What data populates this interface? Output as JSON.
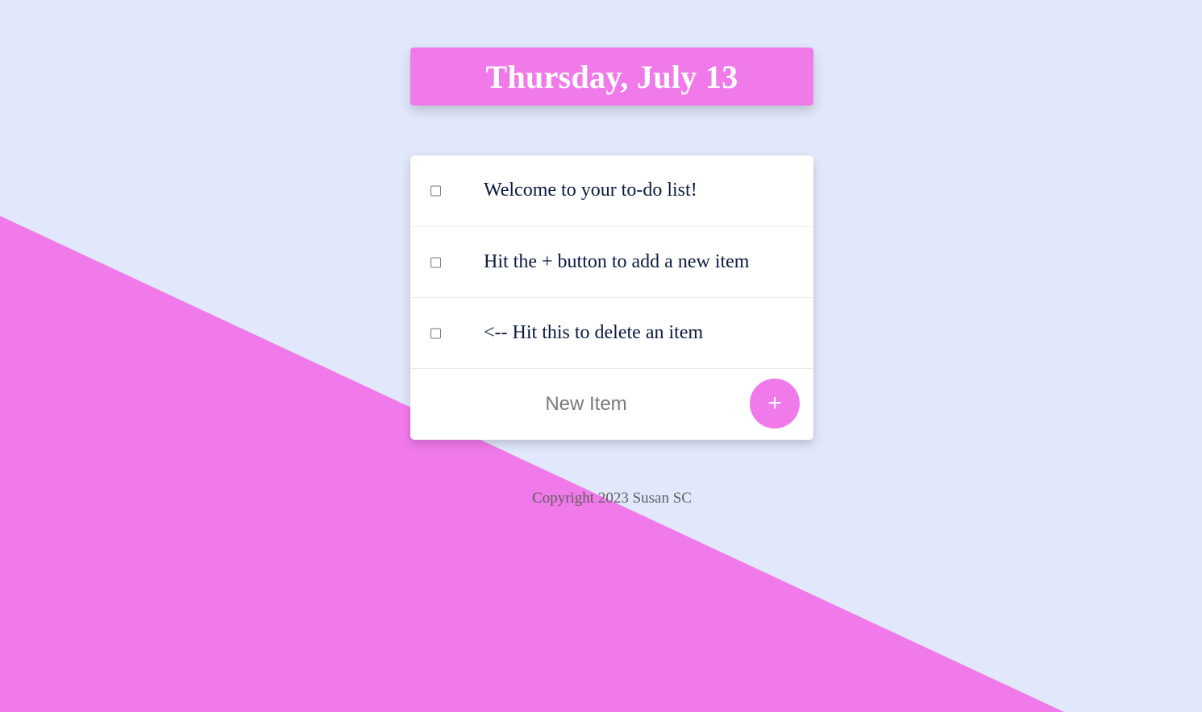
{
  "colors": {
    "background": "#E2E8FB",
    "accent": "#F07AEA",
    "item_text": "#0B1A44",
    "footer_text": "#5E5E5E"
  },
  "header": {
    "title": "Thursday, July 13"
  },
  "todo": {
    "items": [
      {
        "text": "Welcome to your to-do list!",
        "checked": false
      },
      {
        "text": "Hit the + button to add a new item",
        "checked": false
      },
      {
        "text": "<-- Hit this to delete an item",
        "checked": false
      }
    ],
    "new_item": {
      "placeholder": "New Item",
      "value": ""
    },
    "add_button_label": "+"
  },
  "footer": {
    "copyright": "Copyright 2023 Susan SC"
  }
}
